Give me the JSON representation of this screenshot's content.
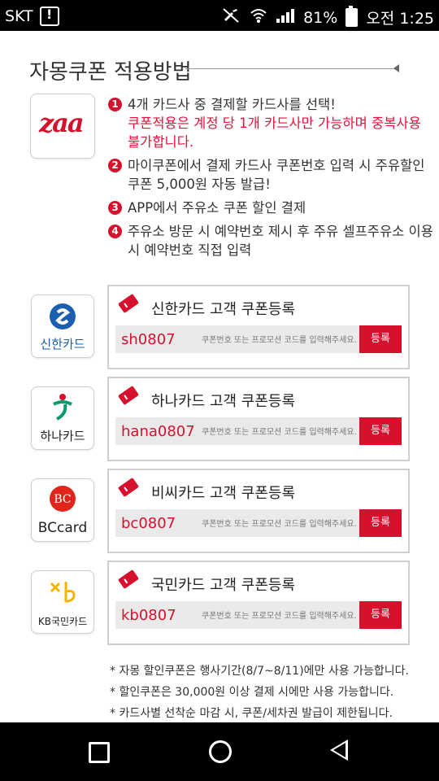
{
  "status": {
    "carrier": "SKT",
    "battery": "81%",
    "time": "오전 1:25",
    "icons": [
      "alert-icon",
      "mute-icon",
      "wifi-icon",
      "signal-icon",
      "battery-icon"
    ]
  },
  "page": {
    "title": "자몽쿠폰 적용방법",
    "za_logo": "zaa"
  },
  "steps": [
    {
      "num": "1",
      "text": "4개 카드사 중 결제할 카드사를 선택!",
      "note": "쿠폰적용은 계정 당 1개 카드사만 가능하며 중복사용 불가합니다."
    },
    {
      "num": "2",
      "text": "마이쿠폰에서 결제 카드사 쿠폰번호 입력 시 주유할인쿠폰 5,000원 자동 발급!",
      "note": ""
    },
    {
      "num": "3",
      "text": "APP에서 주유소 쿠폰 할인 결제",
      "note": ""
    },
    {
      "num": "4",
      "text": "주유소 방문 시 예약번호 제시 후 주유 셀프주유소 이용 시 예약번호 직접 입력",
      "note": ""
    }
  ],
  "cards": [
    {
      "logo_label": "신한카드",
      "title": "신한카드 고객 쿠폰등록",
      "code": "sh0807",
      "placeholder": "쿠폰번호 또는 프로모션 코드를 입력해주세요.",
      "button": "등록"
    },
    {
      "logo_label": "하나카드",
      "title": "하나카드 고객 쿠폰등록",
      "code": "hana0807",
      "placeholder": "쿠폰번호 또는 프로모션 코드를 입력해주세요.",
      "button": "등록"
    },
    {
      "logo_label": "BCcard",
      "title": "비씨카드 고객 쿠폰등록",
      "code": "bc0807",
      "placeholder": "쿠폰번호 또는 프로모션 코드를 입력해주세요.",
      "button": "등록"
    },
    {
      "logo_label": "KB국민카드",
      "title": "국민카드 고객 쿠폰등록",
      "code": "kb0807",
      "placeholder": "쿠폰번호 또는 프로모션 코드를 입력해주세요.",
      "button": "등록"
    }
  ],
  "notes": [
    "* 자몽 할인쿠폰은 행사기간(8/7~8/11)에만 사용 가능합니다.",
    "* 할인쿠폰은 30,000원 이상 결제 시에만 사용 가능합니다.",
    "* 카드사별 선착순 마감 시, 쿠폰/세차권 발급이 제한됩니다."
  ],
  "colors": {
    "accent": "#d6112e"
  }
}
